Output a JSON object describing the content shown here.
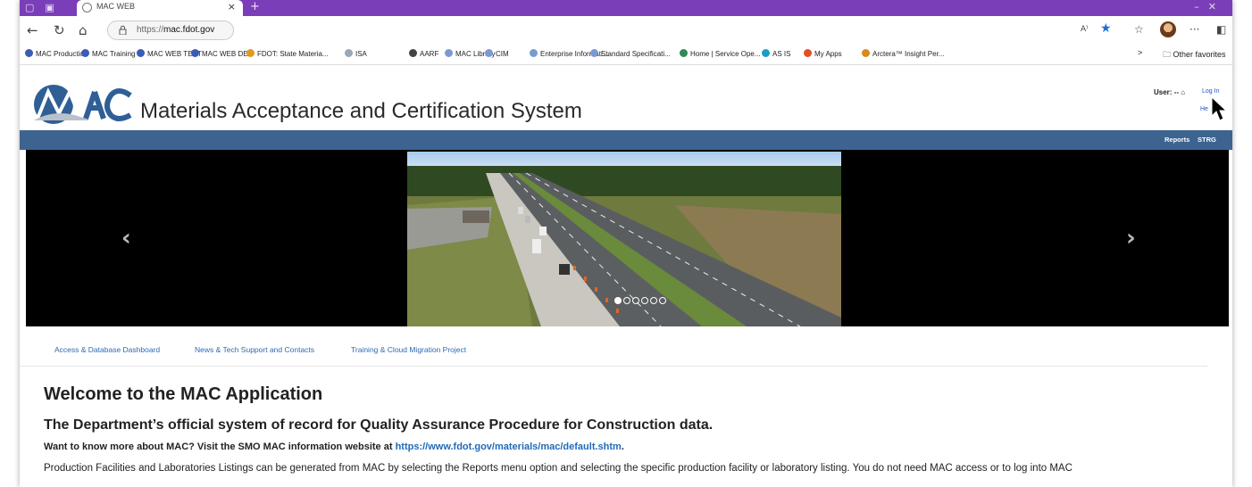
{
  "browser": {
    "tab_title": "MAC WEB",
    "tab_close": "×",
    "new_tab": "+",
    "url_scheme": "https://",
    "url_host": "mac.fdot.gov",
    "read_aloud": "A⁾",
    "more": "···"
  },
  "bookmarks": [
    {
      "label": "MAC Production",
      "color": "#3b5bb5"
    },
    {
      "label": "MAC Training",
      "color": "#3b5bb5"
    },
    {
      "label": "MAC WEB TEST",
      "color": "#3b5bb5"
    },
    {
      "label": "MAC WEB DEV",
      "color": "#3b5bb5"
    },
    {
      "label": "FDOT: State Materia...",
      "color": "#e09b1c"
    },
    {
      "label": "ISA",
      "color": "#9aa7b5"
    },
    {
      "label": "AARF",
      "color": "#444444"
    },
    {
      "label": "MAC Library",
      "color": "#7a9ad0"
    },
    {
      "label": "CIM",
      "color": "#7a9ad0"
    },
    {
      "label": "Enterprise Informati...",
      "color": "#7a9ad0"
    },
    {
      "label": "Standard Specificati...",
      "color": "#7a9ad0"
    },
    {
      "label": "Home | Service Ope...",
      "color": "#2e8b57"
    },
    {
      "label": "AS IS",
      "color": "#1a9ec4"
    },
    {
      "label": "My Apps",
      "color": "#e44d26"
    },
    {
      "label": "Arctera™ Insight Per...",
      "color": "#d98a1a"
    }
  ],
  "bookmarks_overflow": ">",
  "other_favorites": "Other favorites",
  "site": {
    "title": "Materials Acceptance and Certification System",
    "user_label": "User: --",
    "login": "Log In",
    "help": "He",
    "nav": [
      "Reports",
      "STRG"
    ]
  },
  "carousel": {
    "prev": "‹",
    "next": "›",
    "slide_count": 6,
    "active_index": 0
  },
  "tabs": [
    "Access & Database Dashboard",
    "News & Tech Support and Contacts",
    "Training & Cloud Migration Project"
  ],
  "content": {
    "heading": "Welcome to the MAC Application",
    "subheading": "The Department’s official system of record for Quality Assurance Procedure for Construction data.",
    "info_prefix": "Want to know more about MAC? Visit the SMO MAC information website at ",
    "info_link": "https://www.fdot.gov/materials/mac/default.shtm",
    "info_suffix": ".",
    "paragraph": "Production Facilities and Laboratories Listings can be generated from MAC by selecting the Reports menu option and selecting the specific production facility or laboratory listing. You do not need MAC access or to log into MAC"
  },
  "colors": {
    "tabstrip": "#7a3fb8",
    "sitenav": "#3d6490",
    "link": "#1f6bb8"
  }
}
